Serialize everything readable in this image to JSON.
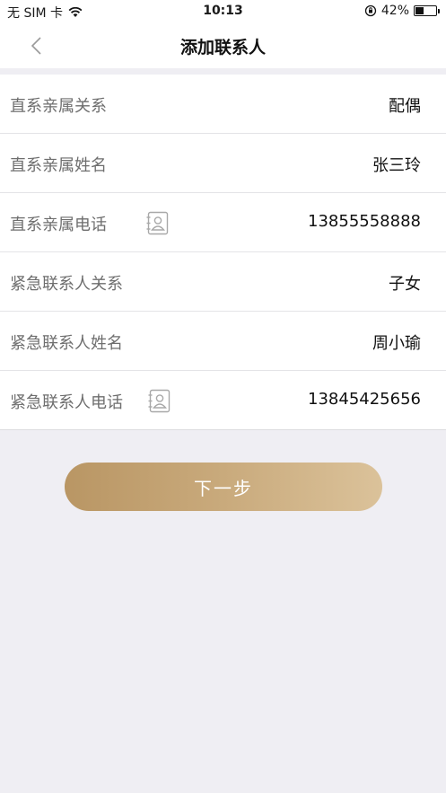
{
  "status_bar": {
    "carrier": "无 SIM 卡",
    "time": "10:13",
    "battery_percent": "42%",
    "battery_level": 0.42,
    "icons": [
      "wifi-icon",
      "orientation-lock-icon",
      "battery-icon"
    ]
  },
  "nav": {
    "title": "添加联系人",
    "back_icon": "chevron-left-icon"
  },
  "form": {
    "rows": [
      {
        "label": "直系亲属关系",
        "value": "配偶",
        "has_contact_icon": false
      },
      {
        "label": "直系亲属姓名",
        "value": "张三玲",
        "has_contact_icon": false
      },
      {
        "label": "直系亲属电话",
        "value": "13855558888",
        "has_contact_icon": true
      },
      {
        "label": "紧急联系人关系",
        "value": "子女",
        "has_contact_icon": false
      },
      {
        "label": "紧急联系人姓名",
        "value": "周小瑜",
        "has_contact_icon": false
      },
      {
        "label": "紧急联系人电话",
        "value": "13845425656",
        "has_contact_icon": true
      }
    ]
  },
  "next_button": {
    "label": "下一步"
  },
  "colors": {
    "background": "#efeef3",
    "button_gradient_start": "#b99664",
    "button_gradient_end": "#dbc29a",
    "label_text": "#6e6e6e",
    "value_text": "#111111"
  }
}
